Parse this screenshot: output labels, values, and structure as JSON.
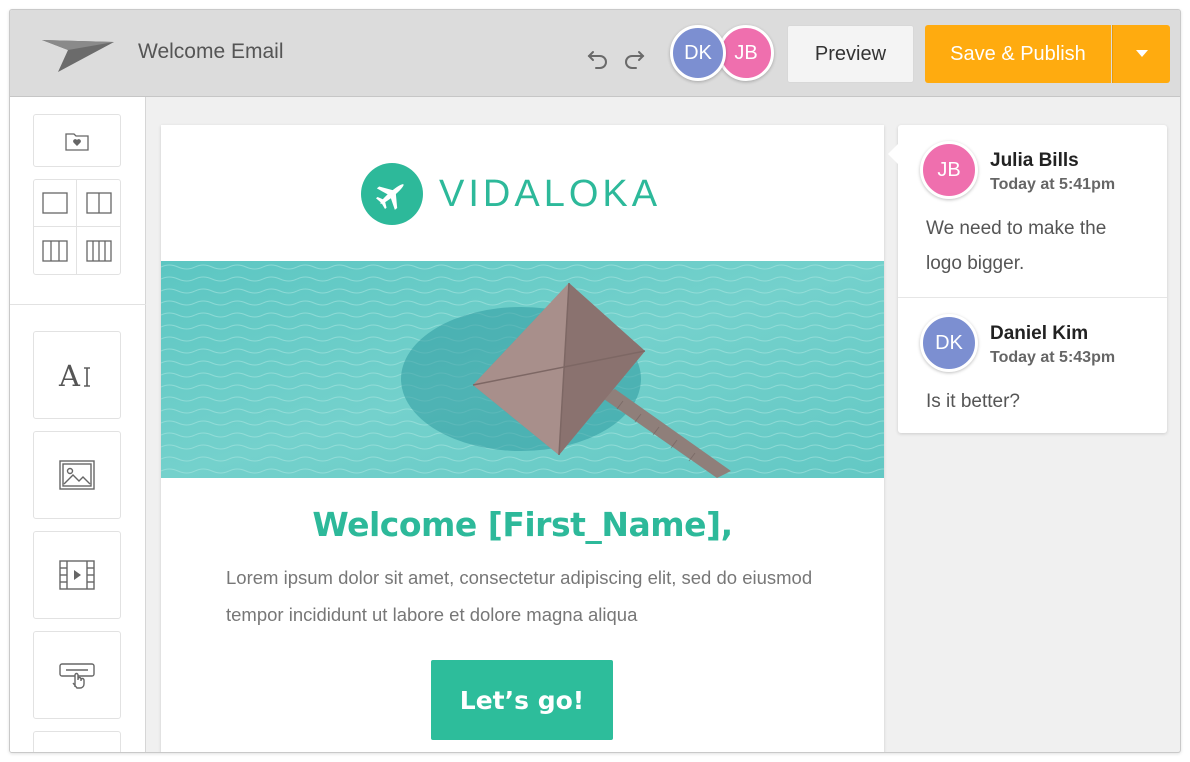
{
  "header": {
    "title": "Welcome Email",
    "collaborators": [
      {
        "initials": "DK",
        "color": "#7c8fd1"
      },
      {
        "initials": "JB",
        "color": "#ef6fae"
      }
    ],
    "preview_label": "Preview",
    "publish_label": "Save & Publish"
  },
  "sidebar": {
    "tools": [
      "folder-heart-icon",
      "one-column-layout-icon",
      "two-column-layout-icon",
      "three-column-layout-icon",
      "four-column-layout-icon",
      "text-block-icon",
      "image-block-icon",
      "video-block-icon",
      "button-block-icon"
    ]
  },
  "email": {
    "brand": "VIDALOKA",
    "headline": "Welcome [First_Name],",
    "body": "Lorem ipsum dolor sit amet, consectetur adipiscing elit, sed do eiusmod tempor incididunt ut labore et dolore magna aliqua",
    "cta_label": "Let’s go!",
    "accent_color": "#2db99a"
  },
  "comments": [
    {
      "initials": "JB",
      "name": "Julia Bills",
      "time": "Today at 5:41pm",
      "text": "We need to make the logo bigger.",
      "color": "#ef6fae"
    },
    {
      "initials": "DK",
      "name": "Daniel Kim",
      "time": "Today at 5:43pm",
      "text": "Is it better?",
      "color": "#7c8fd1"
    }
  ],
  "colors": {
    "publish": "#ffab0f",
    "topbar": "#dcdcdc"
  }
}
